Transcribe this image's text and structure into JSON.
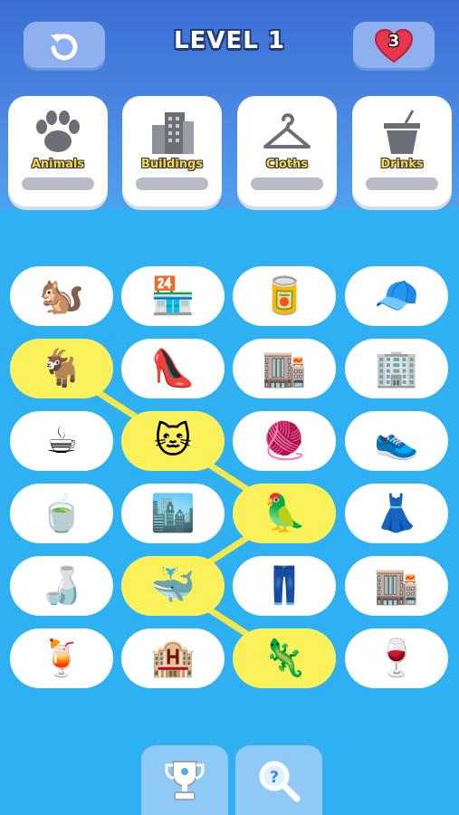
{
  "header": {
    "level_label": "LEVEL 1",
    "lives": "3",
    "colors": {
      "heart": "#e8364f",
      "title_outline": "#243a7a"
    }
  },
  "categories": [
    {
      "label": "Animals",
      "icon": "paw-icon",
      "progress": 0
    },
    {
      "label": "Buildings",
      "icon": "buildings-icon",
      "progress": 0
    },
    {
      "label": "Cloths",
      "icon": "hanger-icon",
      "progress": 0
    },
    {
      "label": "Drinks",
      "icon": "cup-icon",
      "progress": 0
    }
  ],
  "grid": {
    "rows": [
      [
        {
          "item": "squirrel",
          "glyph": "🐿️",
          "selected": false
        },
        {
          "item": "shop",
          "glyph": "🏪",
          "selected": false
        },
        {
          "item": "soda-can",
          "glyph": "🥫",
          "selected": false
        },
        {
          "item": "cap",
          "glyph": "🧢",
          "selected": false
        }
      ],
      [
        {
          "item": "goat",
          "glyph": "🐐",
          "selected": true
        },
        {
          "item": "high-heel",
          "glyph": "👠",
          "selected": false
        },
        {
          "item": "building",
          "glyph": "🏬",
          "selected": false
        },
        {
          "item": "store",
          "glyph": "🏢",
          "selected": false
        }
      ],
      [
        {
          "item": "coffee",
          "glyph": "☕",
          "selected": false
        },
        {
          "item": "cat",
          "glyph": "🐱",
          "selected": true
        },
        {
          "item": "beanie",
          "glyph": "🧶",
          "selected": false
        },
        {
          "item": "sneaker",
          "glyph": "👟",
          "selected": false
        }
      ],
      [
        {
          "item": "tea",
          "glyph": "🍵",
          "selected": false
        },
        {
          "item": "office",
          "glyph": "🏙️",
          "selected": false
        },
        {
          "item": "parrot",
          "glyph": "🦜",
          "selected": true
        },
        {
          "item": "dress",
          "glyph": "👗",
          "selected": false
        }
      ],
      [
        {
          "item": "water-bottle",
          "glyph": "🍶",
          "selected": false
        },
        {
          "item": "whale",
          "glyph": "🐳",
          "selected": true
        },
        {
          "item": "jeans",
          "glyph": "👖",
          "selected": false
        },
        {
          "item": "market",
          "glyph": "🏬",
          "selected": false
        }
      ],
      [
        {
          "item": "juice",
          "glyph": "🍹",
          "selected": false
        },
        {
          "item": "apartment",
          "glyph": "🏨",
          "selected": false
        },
        {
          "item": "chameleon",
          "glyph": "🦎",
          "selected": true
        },
        {
          "item": "wine",
          "glyph": "🍷",
          "selected": false
        }
      ]
    ],
    "selection_path": [
      [
        1,
        0
      ],
      [
        2,
        1
      ],
      [
        3,
        2
      ],
      [
        4,
        1
      ],
      [
        5,
        2
      ]
    ],
    "colors": {
      "selected": "#fbf25b",
      "link": "#f3e84a"
    }
  },
  "bottom_bar": [
    {
      "name": "trophy",
      "icon": "trophy-icon"
    },
    {
      "name": "hint",
      "icon": "magnifier-icon"
    }
  ]
}
